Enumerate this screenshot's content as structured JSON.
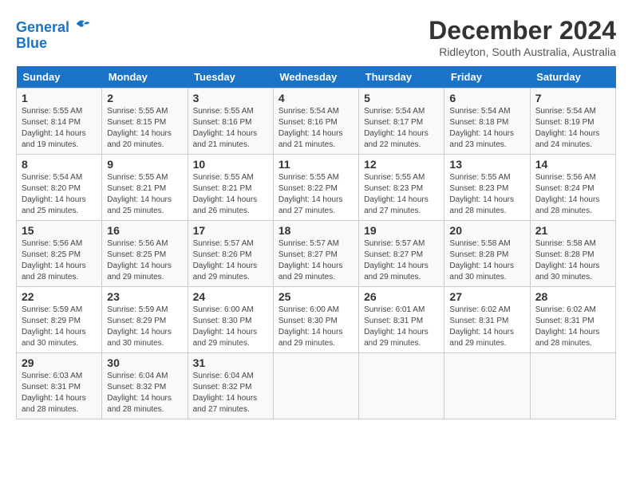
{
  "header": {
    "logo_line1": "General",
    "logo_line2": "Blue",
    "month_title": "December 2024",
    "location": "Ridleyton, South Australia, Australia"
  },
  "weekdays": [
    "Sunday",
    "Monday",
    "Tuesday",
    "Wednesday",
    "Thursday",
    "Friday",
    "Saturday"
  ],
  "weeks": [
    [
      {
        "day": "1",
        "sunrise": "5:55 AM",
        "sunset": "8:14 PM",
        "daylight": "14 hours and 19 minutes."
      },
      {
        "day": "2",
        "sunrise": "5:55 AM",
        "sunset": "8:15 PM",
        "daylight": "14 hours and 20 minutes."
      },
      {
        "day": "3",
        "sunrise": "5:55 AM",
        "sunset": "8:16 PM",
        "daylight": "14 hours and 21 minutes."
      },
      {
        "day": "4",
        "sunrise": "5:54 AM",
        "sunset": "8:16 PM",
        "daylight": "14 hours and 21 minutes."
      },
      {
        "day": "5",
        "sunrise": "5:54 AM",
        "sunset": "8:17 PM",
        "daylight": "14 hours and 22 minutes."
      },
      {
        "day": "6",
        "sunrise": "5:54 AM",
        "sunset": "8:18 PM",
        "daylight": "14 hours and 23 minutes."
      },
      {
        "day": "7",
        "sunrise": "5:54 AM",
        "sunset": "8:19 PM",
        "daylight": "14 hours and 24 minutes."
      }
    ],
    [
      {
        "day": "8",
        "sunrise": "5:54 AM",
        "sunset": "8:20 PM",
        "daylight": "14 hours and 25 minutes."
      },
      {
        "day": "9",
        "sunrise": "5:55 AM",
        "sunset": "8:21 PM",
        "daylight": "14 hours and 25 minutes."
      },
      {
        "day": "10",
        "sunrise": "5:55 AM",
        "sunset": "8:21 PM",
        "daylight": "14 hours and 26 minutes."
      },
      {
        "day": "11",
        "sunrise": "5:55 AM",
        "sunset": "8:22 PM",
        "daylight": "14 hours and 27 minutes."
      },
      {
        "day": "12",
        "sunrise": "5:55 AM",
        "sunset": "8:23 PM",
        "daylight": "14 hours and 27 minutes."
      },
      {
        "day": "13",
        "sunrise": "5:55 AM",
        "sunset": "8:23 PM",
        "daylight": "14 hours and 28 minutes."
      },
      {
        "day": "14",
        "sunrise": "5:56 AM",
        "sunset": "8:24 PM",
        "daylight": "14 hours and 28 minutes."
      }
    ],
    [
      {
        "day": "15",
        "sunrise": "5:56 AM",
        "sunset": "8:25 PM",
        "daylight": "14 hours and 28 minutes."
      },
      {
        "day": "16",
        "sunrise": "5:56 AM",
        "sunset": "8:25 PM",
        "daylight": "14 hours and 29 minutes."
      },
      {
        "day": "17",
        "sunrise": "5:57 AM",
        "sunset": "8:26 PM",
        "daylight": "14 hours and 29 minutes."
      },
      {
        "day": "18",
        "sunrise": "5:57 AM",
        "sunset": "8:27 PM",
        "daylight": "14 hours and 29 minutes."
      },
      {
        "day": "19",
        "sunrise": "5:57 AM",
        "sunset": "8:27 PM",
        "daylight": "14 hours and 29 minutes."
      },
      {
        "day": "20",
        "sunrise": "5:58 AM",
        "sunset": "8:28 PM",
        "daylight": "14 hours and 30 minutes."
      },
      {
        "day": "21",
        "sunrise": "5:58 AM",
        "sunset": "8:28 PM",
        "daylight": "14 hours and 30 minutes."
      }
    ],
    [
      {
        "day": "22",
        "sunrise": "5:59 AM",
        "sunset": "8:29 PM",
        "daylight": "14 hours and 30 minutes."
      },
      {
        "day": "23",
        "sunrise": "5:59 AM",
        "sunset": "8:29 PM",
        "daylight": "14 hours and 30 minutes."
      },
      {
        "day": "24",
        "sunrise": "6:00 AM",
        "sunset": "8:30 PM",
        "daylight": "14 hours and 29 minutes."
      },
      {
        "day": "25",
        "sunrise": "6:00 AM",
        "sunset": "8:30 PM",
        "daylight": "14 hours and 29 minutes."
      },
      {
        "day": "26",
        "sunrise": "6:01 AM",
        "sunset": "8:31 PM",
        "daylight": "14 hours and 29 minutes."
      },
      {
        "day": "27",
        "sunrise": "6:02 AM",
        "sunset": "8:31 PM",
        "daylight": "14 hours and 29 minutes."
      },
      {
        "day": "28",
        "sunrise": "6:02 AM",
        "sunset": "8:31 PM",
        "daylight": "14 hours and 28 minutes."
      }
    ],
    [
      {
        "day": "29",
        "sunrise": "6:03 AM",
        "sunset": "8:31 PM",
        "daylight": "14 hours and 28 minutes."
      },
      {
        "day": "30",
        "sunrise": "6:04 AM",
        "sunset": "8:32 PM",
        "daylight": "14 hours and 28 minutes."
      },
      {
        "day": "31",
        "sunrise": "6:04 AM",
        "sunset": "8:32 PM",
        "daylight": "14 hours and 27 minutes."
      },
      null,
      null,
      null,
      null
    ]
  ]
}
